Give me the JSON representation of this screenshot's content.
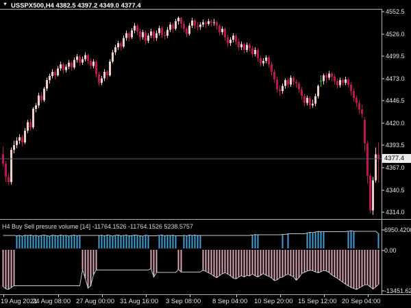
{
  "window": {
    "background": "#000000",
    "border_color": "#b3b3b3"
  },
  "title_bar": {
    "collapse_arrow": "▼",
    "symbol_period": "USSPX500,H4",
    "ohlc_values": "4382.5 4397.2 4349.0 4377.4"
  },
  "price_axis": {
    "labels": [
      "4552.5",
      "4526.0",
      "4499.5",
      "4473.0",
      "4446.5",
      "4420.0",
      "4393.5",
      "4367.0",
      "4340.5",
      "4314.0"
    ],
    "values": [
      4552.5,
      4526.0,
      4499.5,
      4473.0,
      4446.5,
      4420.0,
      4393.5,
      4367.0,
      4340.5,
      4314.0
    ],
    "current_price": "4377.4",
    "current_price_value": 4377.4
  },
  "time_axis": {
    "labels": [
      {
        "text": "19 Aug 2021",
        "bar": 0
      },
      {
        "text": "24 Aug 08:00",
        "bar": 20
      },
      {
        "text": "27 Aug 00:00",
        "bar": 36
      },
      {
        "text": "31 Aug 16:00",
        "bar": 52
      },
      {
        "text": "3 Sep 08:00",
        "bar": 68
      },
      {
        "text": "8 Sep 04:00",
        "bar": 85
      },
      {
        "text": "10 Sep 20:00",
        "bar": 101
      },
      {
        "text": "15 Sep 12:00",
        "bar": 117
      },
      {
        "text": "20 Sep 04:00",
        "bar": 133
      }
    ]
  },
  "indicator_pane": {
    "name": "H4 Buy Sell presure volume [14]",
    "values_text": "-11764.1526 -11764.1526 5238.5757",
    "axis_labels": [
      {
        "text": "6950.4200",
        "value": 6950.42
      },
      {
        "text": "0.00",
        "value": 0
      },
      {
        "text": "-13451.62",
        "value": -13451.62
      }
    ]
  },
  "colors": {
    "bull": "#f2cfc6",
    "bear": "#c01355",
    "doji": "#2db82d",
    "bid_line": "#51606c",
    "buy_bar": "#3f9fd6",
    "sell_bar": "#dca4b2",
    "envelope_line": "#c2c6ca",
    "axis_text": "#e4e4e4",
    "separator": "#b3b3b3"
  },
  "chart_data": [
    {
      "type": "candlestick",
      "title": "USSPX500,H4",
      "current_bar": {
        "open": 4382.5,
        "high": 4397.2,
        "low": 4349.0,
        "close": 4377.4
      },
      "price_range_labels": [
        4552.5,
        4314.0
      ],
      "bars": [
        [
          4383,
          4392,
          4368,
          4372
        ],
        [
          4372,
          4375,
          4350,
          4356
        ],
        [
          4356,
          4360,
          4346,
          4350
        ],
        [
          4350,
          4391,
          4347,
          4388
        ],
        [
          4388,
          4399,
          4384,
          4394
        ],
        [
          4394,
          4403,
          4390,
          4399
        ],
        [
          4399,
          4407,
          4395,
          4403
        ],
        [
          4403,
          4406,
          4392,
          4397
        ],
        [
          4397,
          4414,
          4395,
          4411
        ],
        [
          4411,
          4424,
          4408,
          4421
        ],
        [
          4421,
          4425,
          4411,
          4415
        ],
        [
          4415,
          4439,
          4413,
          4437
        ],
        [
          4437,
          4444,
          4433,
          4441
        ],
        [
          4441,
          4456,
          4438,
          4453
        ],
        [
          4453,
          4457,
          4444,
          4447
        ],
        [
          4447,
          4463,
          4445,
          4461
        ],
        [
          4461,
          4474,
          4458,
          4471
        ],
        [
          4471,
          4479,
          4467,
          4476
        ],
        [
          4476,
          4484,
          4473,
          4481
        ],
        [
          4481,
          4483,
          4472,
          4477
        ],
        [
          4477,
          4488,
          4475,
          4485
        ],
        [
          4485,
          4493,
          4482,
          4490
        ],
        [
          4490,
          4492,
          4479,
          4483
        ],
        [
          4483,
          4490,
          4480,
          4487
        ],
        [
          4487,
          4495,
          4484,
          4492
        ],
        [
          4492,
          4494,
          4482,
          4486
        ],
        [
          4486,
          4498,
          4484,
          4495
        ],
        [
          4495,
          4502,
          4492,
          4499
        ],
        [
          4499,
          4501,
          4488,
          4492
        ],
        [
          4492,
          4499,
          4489,
          4496
        ],
        [
          4496,
          4504,
          4493,
          4501
        ],
        [
          4501,
          4503,
          4490,
          4494
        ],
        [
          4494,
          4497,
          4484,
          4488
        ],
        [
          4488,
          4496,
          4485,
          4493
        ],
        [
          4493,
          4495,
          4474,
          4478
        ],
        [
          4478,
          4481,
          4464,
          4468
        ],
        [
          4468,
          4476,
          4465,
          4473
        ],
        [
          4473,
          4484,
          4470,
          4481
        ],
        [
          4481,
          4483,
          4472,
          4477
        ],
        [
          4477,
          4496,
          4475,
          4493
        ],
        [
          4493,
          4507,
          4491,
          4504
        ],
        [
          4504,
          4513,
          4501,
          4510
        ],
        [
          4510,
          4518,
          4507,
          4515
        ],
        [
          4515,
          4517,
          4506,
          4511
        ],
        [
          4511,
          4524,
          4509,
          4521
        ],
        [
          4521,
          4530,
          4518,
          4527
        ],
        [
          4527,
          4529,
          4517,
          4522
        ],
        [
          4522,
          4533,
          4520,
          4530
        ],
        [
          4530,
          4539,
          4527,
          4536
        ],
        [
          4536,
          4538,
          4525,
          4529
        ],
        [
          4529,
          4532,
          4517,
          4522
        ],
        [
          4522,
          4531,
          4519,
          4528
        ],
        [
          4528,
          4530,
          4513,
          4518
        ],
        [
          4518,
          4527,
          4515,
          4524
        ],
        [
          4524,
          4532,
          4521,
          4529
        ],
        [
          4529,
          4531,
          4517,
          4521
        ],
        [
          4521,
          4530,
          4518,
          4527
        ],
        [
          4527,
          4536,
          4524,
          4533
        ],
        [
          4533,
          4535,
          4521,
          4525
        ],
        [
          4525,
          4529,
          4519,
          4524
        ],
        [
          4524,
          4534,
          4521,
          4531
        ],
        [
          4531,
          4540,
          4528,
          4537
        ],
        [
          4537,
          4539,
          4527,
          4532
        ],
        [
          4532,
          4544,
          4530,
          4541
        ],
        [
          4541,
          4547,
          4537,
          4545
        ],
        [
          4545,
          4546,
          4533,
          4538
        ],
        [
          4538,
          4541,
          4528,
          4532
        ],
        [
          4532,
          4534,
          4522,
          4526
        ],
        [
          4526,
          4539,
          4524,
          4536
        ],
        [
          4536,
          4545,
          4533,
          4542
        ],
        [
          4542,
          4544,
          4532,
          4536
        ],
        [
          4536,
          4540,
          4530,
          4534
        ],
        [
          4534,
          4540,
          4531,
          4537
        ],
        [
          4537,
          4543,
          4534,
          4540
        ],
        [
          4540,
          4542,
          4533,
          4538
        ],
        [
          4538,
          4544,
          4536,
          4541
        ],
        [
          4541,
          4543,
          4535,
          4539
        ],
        [
          4539,
          4544,
          4536,
          4540
        ],
        [
          4540,
          4542,
          4531,
          4536
        ],
        [
          4536,
          4538,
          4524,
          4528
        ],
        [
          4528,
          4535,
          4525,
          4532
        ],
        [
          4532,
          4534,
          4518,
          4522
        ],
        [
          4522,
          4525,
          4510,
          4515
        ],
        [
          4515,
          4522,
          4512,
          4519
        ],
        [
          4519,
          4527,
          4516,
          4524
        ],
        [
          4524,
          4526,
          4513,
          4517
        ],
        [
          4517,
          4520,
          4506,
          4510
        ],
        [
          4510,
          4517,
          4507,
          4514
        ],
        [
          4514,
          4516,
          4503,
          4507
        ],
        [
          4507,
          4516,
          4504,
          4513
        ],
        [
          4513,
          4515,
          4505,
          4509
        ],
        [
          4509,
          4512,
          4498,
          4502
        ],
        [
          4502,
          4510,
          4499,
          4507
        ],
        [
          4507,
          4509,
          4493,
          4497
        ],
        [
          4497,
          4500,
          4487,
          4491
        ],
        [
          4491,
          4497,
          4488,
          4494
        ],
        [
          4494,
          4501,
          4491,
          4498
        ],
        [
          4498,
          4500,
          4486,
          4490
        ],
        [
          4490,
          4493,
          4477,
          4481
        ],
        [
          4481,
          4484,
          4468,
          4472
        ],
        [
          4472,
          4475,
          4456,
          4460
        ],
        [
          4460,
          4465,
          4452,
          4458
        ],
        [
          4458,
          4467,
          4455,
          4464
        ],
        [
          4464,
          4473,
          4461,
          4471
        ],
        [
          4471,
          4473,
          4462,
          4466
        ],
        [
          4466,
          4477,
          4463,
          4474
        ],
        [
          4474,
          4476,
          4465,
          4469
        ],
        [
          4469,
          4472,
          4462,
          4467
        ],
        [
          4467,
          4469,
          4456,
          4460
        ],
        [
          4460,
          4463,
          4448,
          4452
        ],
        [
          4452,
          4455,
          4440,
          4444
        ],
        [
          4444,
          4453,
          4441,
          4450
        ],
        [
          4450,
          4452,
          4437,
          4441
        ],
        [
          4441,
          4448,
          4438,
          4443
        ],
        [
          4443,
          4455,
          4440,
          4452
        ],
        [
          4452,
          4466,
          4449,
          4464
        ],
        [
          4470,
          4477,
          4463,
          4470
        ],
        [
          4470,
          4479,
          4466,
          4477
        ],
        [
          4477,
          4480,
          4468,
          4474
        ],
        [
          4474,
          4482,
          4471,
          4479
        ],
        [
          4479,
          4481,
          4470,
          4475
        ],
        [
          4475,
          4478,
          4466,
          4470
        ],
        [
          4470,
          4473,
          4461,
          4465
        ],
        [
          4465,
          4474,
          4462,
          4471
        ],
        [
          4471,
          4473,
          4464,
          4468
        ],
        [
          4468,
          4475,
          4465,
          4472
        ],
        [
          4472,
          4474,
          4462,
          4466
        ],
        [
          4466,
          4469,
          4453,
          4458
        ],
        [
          4458,
          4461,
          4445,
          4450
        ],
        [
          4450,
          4453,
          4439,
          4444
        ],
        [
          4444,
          4447,
          4431,
          4436
        ],
        [
          4436,
          4442,
          4426,
          4431
        ],
        [
          4424,
          4427,
          4386,
          4396
        ],
        [
          4396,
          4399,
          4348,
          4357
        ],
        [
          4357,
          4360,
          4312,
          4316
        ],
        [
          4316,
          4356,
          4311,
          4352
        ],
        [
          4352,
          4391,
          4349,
          4383
        ],
        [
          4382.5,
          4397.2,
          4349.0,
          4377.4
        ]
      ]
    },
    {
      "type": "bar",
      "title": "H4 Buy Sell presure volume [14]",
      "ylim": [
        -13451.62,
        6950.42
      ],
      "current_values": [
        -11764.1526,
        -11764.1526,
        5238.5757
      ],
      "buy": [
        0,
        0,
        0,
        0,
        0,
        4400,
        4550,
        4300,
        4650,
        4500,
        4700,
        4450,
        4600,
        4350,
        4550,
        4700,
        4500,
        4300,
        4650,
        4550,
        4400,
        4700,
        4500,
        4600,
        4350,
        4550,
        4650,
        4450,
        4600,
        0,
        0,
        0,
        0,
        0,
        0,
        4500,
        4650,
        4400,
        4700,
        4550,
        4350,
        4600,
        4700,
        4450,
        4550,
        4650,
        4400,
        4500,
        4700,
        4600,
        4450,
        4350,
        4650,
        4500,
        0,
        0,
        0,
        4550,
        4700,
        4450,
        4600,
        4500,
        4650,
        4400,
        0,
        0,
        4600,
        4450,
        4700,
        4550,
        4650,
        4500,
        4600,
        0,
        0,
        0,
        0,
        0,
        0,
        0,
        0,
        0,
        0,
        0,
        0,
        0,
        0,
        0,
        0,
        0,
        0,
        4700,
        4850,
        4750,
        0,
        0,
        0,
        0,
        0,
        0,
        0,
        0,
        4900,
        0,
        5100,
        0,
        0,
        0,
        0,
        0,
        0,
        5400,
        5600,
        5500,
        5700,
        5900,
        5750,
        5850,
        0,
        0,
        0,
        0,
        0,
        0,
        0,
        0,
        5900,
        6100,
        5950,
        0,
        0,
        0,
        0,
        0,
        0,
        0,
        0,
        5238.58
      ],
      "sell": [
        12500,
        13200,
        13400,
        12800,
        12200,
        0,
        0,
        0,
        0,
        0,
        0,
        0,
        0,
        0,
        0,
        0,
        0,
        0,
        0,
        0,
        0,
        0,
        0,
        0,
        0,
        0,
        0,
        0,
        0,
        6800,
        9800,
        13000,
        12200,
        8600,
        6900,
        0,
        0,
        0,
        0,
        0,
        0,
        0,
        0,
        0,
        0,
        0,
        0,
        0,
        0,
        0,
        0,
        0,
        0,
        0,
        6500,
        9300,
        7800,
        0,
        0,
        0,
        0,
        0,
        0,
        0,
        6700,
        7600,
        0,
        0,
        0,
        0,
        0,
        0,
        0,
        7000,
        7400,
        7900,
        8400,
        9000,
        9500,
        8800,
        8200,
        7800,
        8300,
        8900,
        9700,
        9900,
        9300,
        8800,
        9300,
        8700,
        8900,
        8300,
        8900,
        9300,
        8700,
        8100,
        8700,
        9100,
        9600,
        10500,
        10200,
        9500,
        9300,
        8700,
        8300,
        8800,
        9200,
        10400,
        9500,
        8100,
        7700,
        7300,
        7000,
        7200,
        7600,
        7900,
        7500,
        7100,
        7300,
        7800,
        8600,
        9200,
        9700,
        10400,
        11000,
        11700,
        12200,
        12800,
        13100,
        13450,
        12900,
        12400,
        11900,
        11800,
        12600,
        13300,
        12600,
        11764.15
      ],
      "line_start_upper": 4600,
      "line_start_lower": -12400
    }
  ]
}
